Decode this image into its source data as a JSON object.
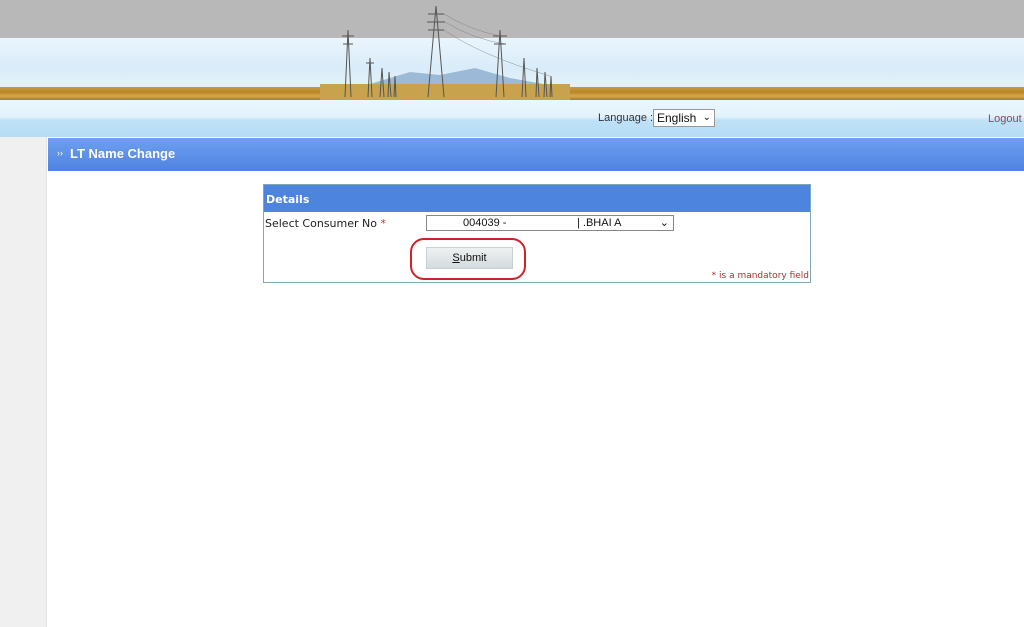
{
  "header": {
    "banner_image": "power-transmission-towers-banner"
  },
  "navbar": {
    "language_label": "Language :",
    "language_selected": "English",
    "logout_label": "Logout"
  },
  "page": {
    "title_icon": "double-chevron-right-icon",
    "title": "LT Name Change"
  },
  "form": {
    "section_title": "Details",
    "consumer_label": "Select Consumer No",
    "required_marker": "*",
    "consumer_selected_part1": "004039 -",
    "consumer_selected_part2": "| .BHAI     A",
    "submit_label_first": "S",
    "submit_label_rest": "ubmit",
    "mandatory_note_marker": "*",
    "mandatory_note": " is a mandatory field"
  },
  "annotation": {
    "highlight_color": "#d0202a",
    "highlight_target": "submit-button"
  },
  "colors": {
    "title_bar": "#5a8fe6",
    "panel_header": "#4d84dd",
    "logout": "#9b3f5a",
    "required": "#c0392b"
  }
}
